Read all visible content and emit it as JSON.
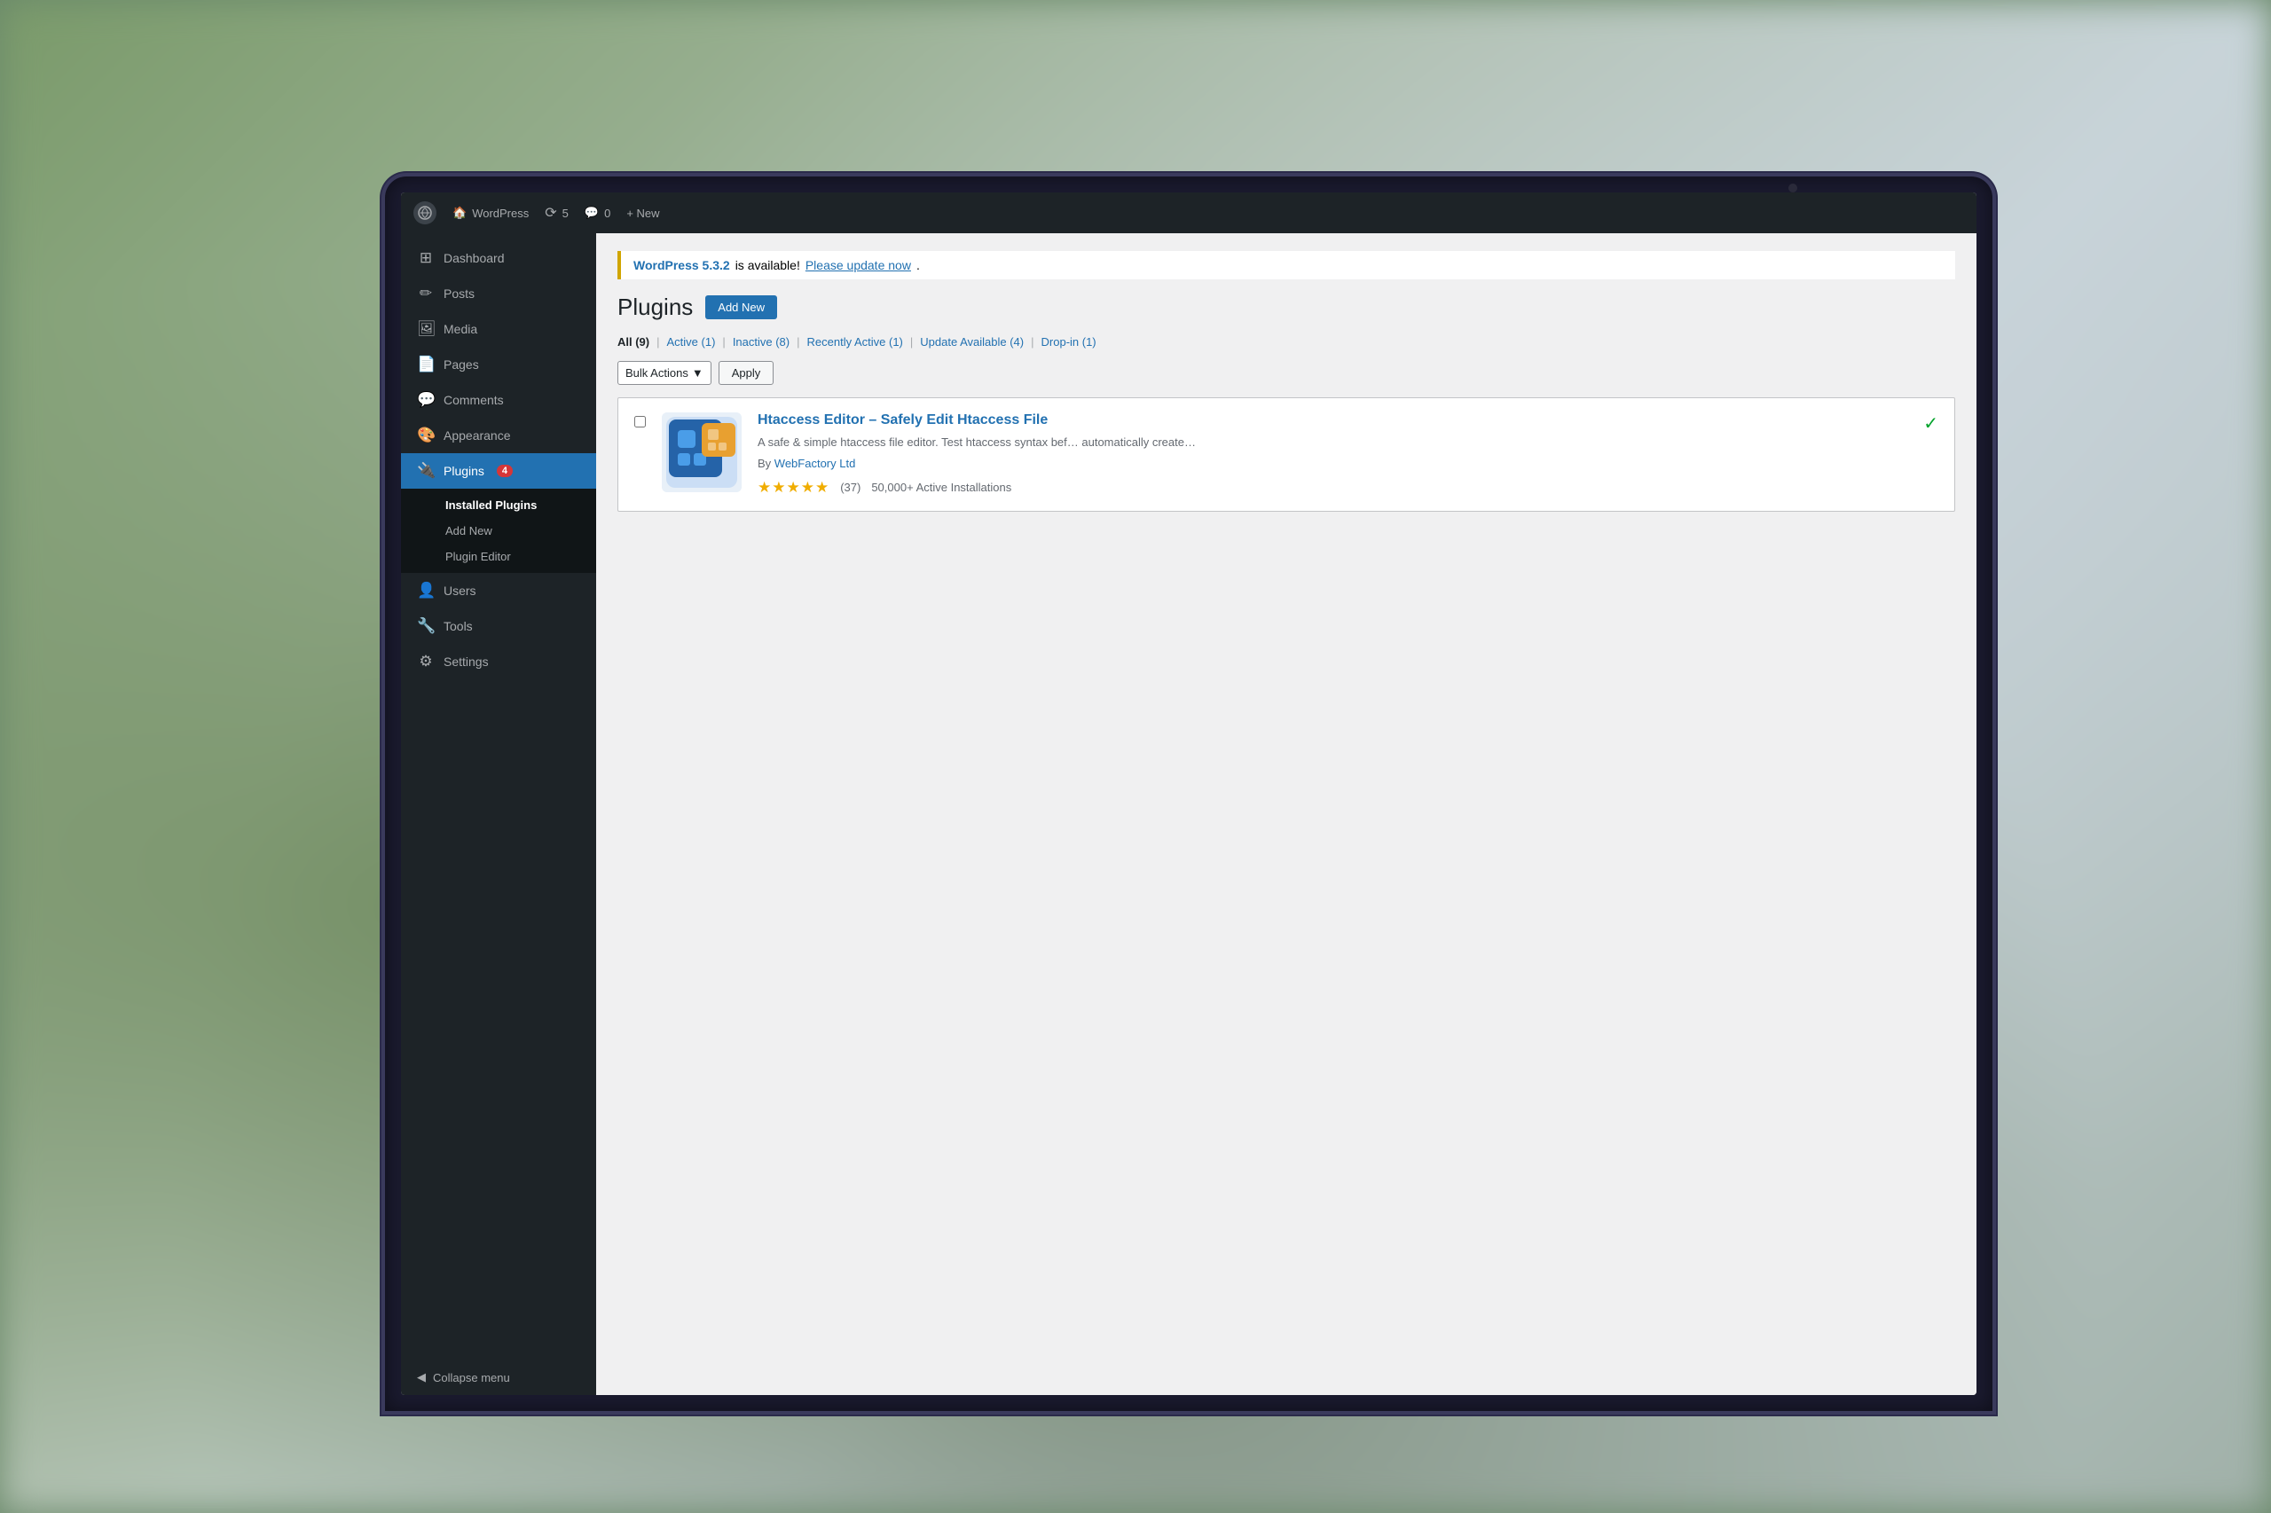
{
  "background": {
    "colors": [
      "#7a9a6a",
      "#b0c0b0",
      "#c8d4d8"
    ]
  },
  "admin_bar": {
    "wp_logo": "W",
    "site_name": "WordPress",
    "updates_icon": "⟳",
    "updates_count": "5",
    "comments_icon": "💬",
    "comments_count": "0",
    "new_label": "+ New"
  },
  "sidebar": {
    "items": [
      {
        "id": "dashboard",
        "label": "Dashboard",
        "icon": "dashboard"
      },
      {
        "id": "posts",
        "label": "Posts",
        "icon": "posts"
      },
      {
        "id": "media",
        "label": "Media",
        "icon": "media"
      },
      {
        "id": "pages",
        "label": "Pages",
        "icon": "pages"
      },
      {
        "id": "comments",
        "label": "Comments",
        "icon": "comments"
      },
      {
        "id": "appearance",
        "label": "Appearance",
        "icon": "appearance"
      },
      {
        "id": "plugins",
        "label": "Plugins",
        "icon": "plugins",
        "badge": "4",
        "active": true
      }
    ],
    "plugins_submenu": [
      {
        "id": "installed",
        "label": "Installed Plugins",
        "active": true
      },
      {
        "id": "add-new",
        "label": "Add New"
      },
      {
        "id": "editor",
        "label": "Plugin Editor"
      }
    ],
    "bottom_items": [
      {
        "id": "users",
        "label": "Users",
        "icon": "users"
      },
      {
        "id": "tools",
        "label": "Tools",
        "icon": "tools"
      },
      {
        "id": "settings",
        "label": "Settings",
        "icon": "settings"
      }
    ],
    "collapse_label": "Collapse menu"
  },
  "main": {
    "notice": {
      "version": "WordPress 5.3.2",
      "text_mid": " is available! ",
      "link_text": "Please update now",
      "text_end": "."
    },
    "page_title": "Plugins",
    "add_new_label": "Add New",
    "filter_tabs": [
      {
        "label": "All",
        "count": "9",
        "active": true
      },
      {
        "label": "Active",
        "count": "1"
      },
      {
        "label": "Inactive",
        "count": "8"
      },
      {
        "label": "Recently Active",
        "count": "1"
      },
      {
        "label": "Update Available",
        "count": "4"
      },
      {
        "label": "Drop-in",
        "count": "1"
      }
    ],
    "bulk_actions": {
      "label": "Bulk Actions",
      "dropdown_arrow": "▼",
      "apply_label": "Apply"
    },
    "plugins": [
      {
        "id": "htaccess-editor",
        "name": "Htaccess Editor – Safely Edit Htaccess File",
        "description": "A safe & simple htaccess file editor. Test htaccess syntax bef… automatically create…",
        "author": "WebFactory Ltd",
        "stars": 5,
        "rating_count": "37",
        "installs": "50,000+ Active Installations",
        "has_check": true
      }
    ]
  }
}
